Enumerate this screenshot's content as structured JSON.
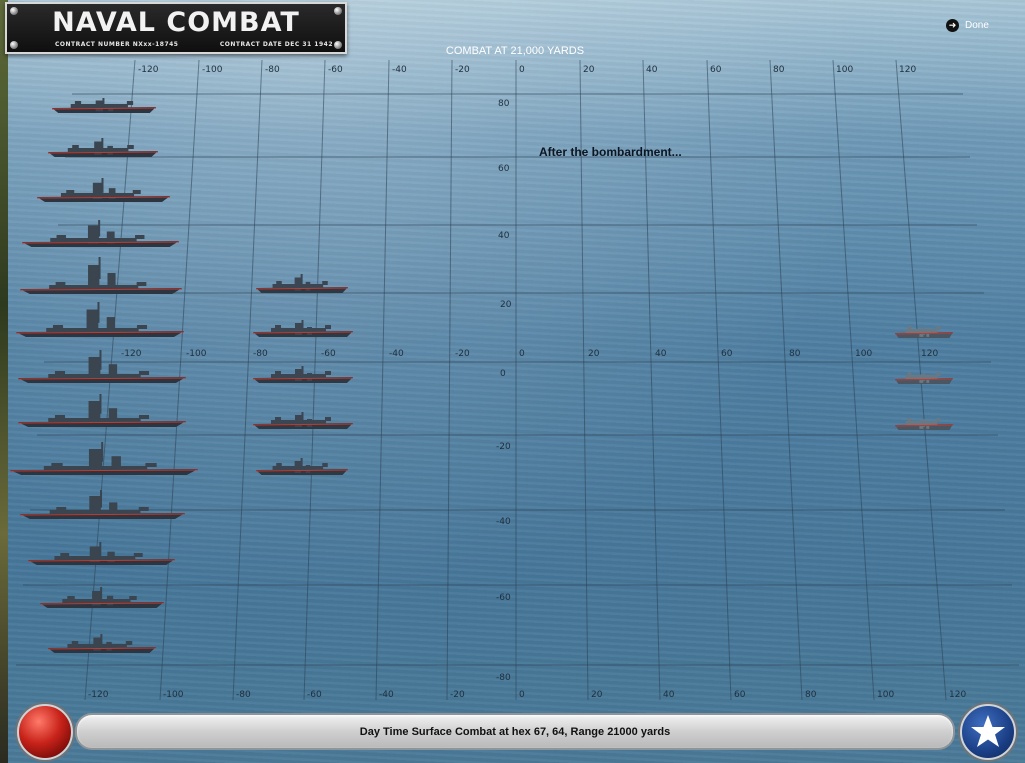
{
  "header": {
    "game_title": "NAVAL COMBAT",
    "contract_number_label": "CONTRACT NUMBER",
    "contract_number_value": "NXxx-18745",
    "contract_date_label": "CONTRACT DATE",
    "contract_date_value": "DEC 31 1942"
  },
  "combat_heading": "COMBAT AT 21,000 YARDS",
  "done_button": {
    "label": "Done",
    "icon": "arrow-right-circle-icon"
  },
  "message": "After the bombardment...",
  "grid": {
    "top_x_ticks": [
      "-120",
      "-100",
      "-80",
      "-60",
      "-40",
      "-20",
      "0",
      "20",
      "40",
      "60",
      "80",
      "100",
      "120"
    ],
    "mid_x_ticks": [
      "-120",
      "-100",
      "-80",
      "-60",
      "-40",
      "-20",
      "0",
      "20",
      "40",
      "60",
      "80",
      "100",
      "120"
    ],
    "bottom_x_ticks": [
      "-120",
      "-100",
      "-80",
      "-60",
      "-40",
      "-20",
      "0",
      "20",
      "40",
      "60",
      "80",
      "100",
      "120"
    ],
    "y_ticks": [
      "80",
      "60",
      "40",
      "20",
      "0",
      "-20",
      "-40",
      "-60",
      "-80"
    ]
  },
  "ships": {
    "own_column_count": 13,
    "own_forward_count": 5,
    "enemy_count": 3
  },
  "status_bar": {
    "text": "Day Time Surface Combat at hex 67, 64, Range 21000 yards"
  },
  "buttons": {
    "left": "red-fire-button-icon",
    "right": "us-star-roundel-icon"
  },
  "colors": {
    "sea": "#4f7fa2",
    "grid_line": "#2b3f52",
    "status_bar": "#cfcfcf",
    "fire_button": "#c8231a",
    "star_button": "#1b3f86"
  }
}
